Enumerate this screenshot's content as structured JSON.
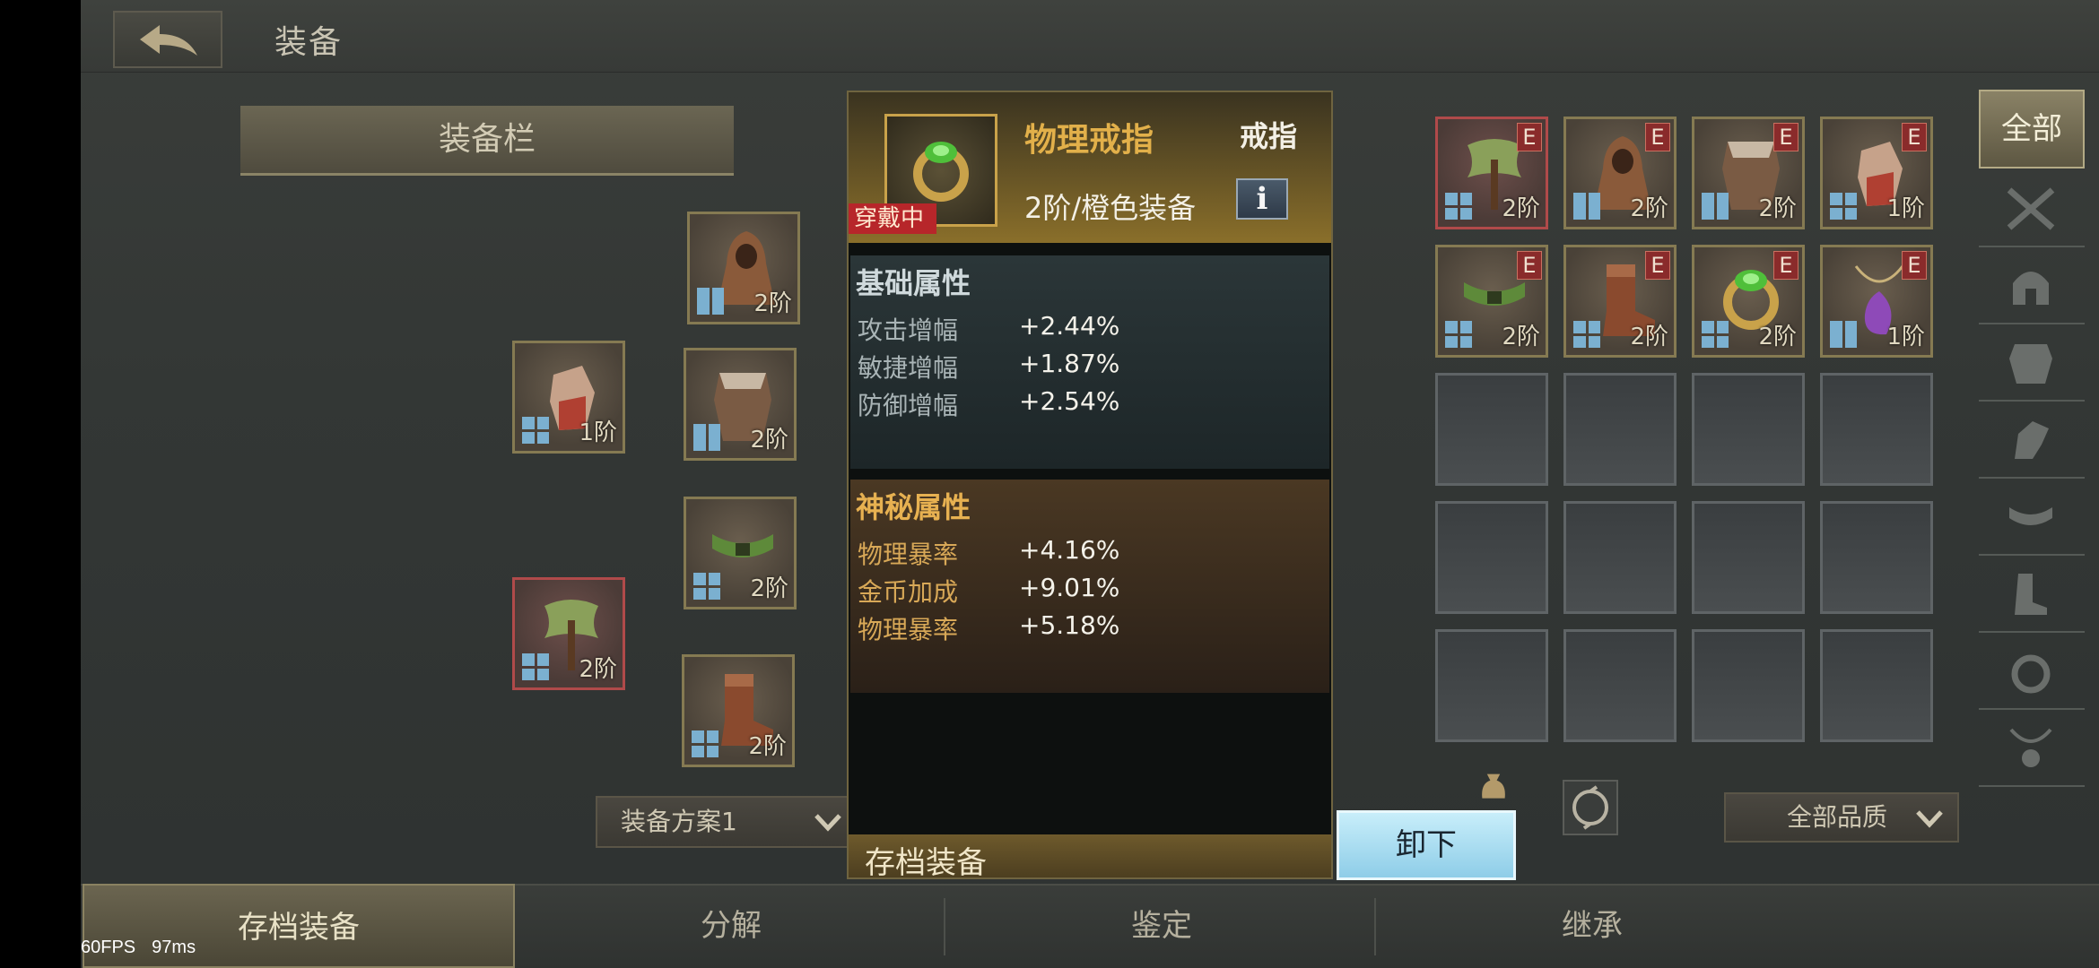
{
  "header": {
    "title": "装备"
  },
  "equipment_panel": {
    "tab_label": "装备栏",
    "preset_label": "装备方案1",
    "slots": [
      {
        "name": "cloak",
        "tier": "2阶"
      },
      {
        "name": "gauntlet",
        "tier": "1阶"
      },
      {
        "name": "armor",
        "tier": "2阶"
      },
      {
        "name": "belt",
        "tier": "2阶"
      },
      {
        "name": "axe",
        "tier": "2阶"
      },
      {
        "name": "boots",
        "tier": "2阶"
      }
    ]
  },
  "tooltip": {
    "item_name": "物理戒指",
    "item_type": "戒指",
    "grade": "2阶/橙色装备",
    "status_badge": "穿戴中",
    "info_glyph": "i",
    "base_title": "基础属性",
    "base_stats": [
      {
        "name": "攻击增幅",
        "value": "+2.44%"
      },
      {
        "name": "敏捷增幅",
        "value": "+1.87%"
      },
      {
        "name": "防御增幅",
        "value": "+2.54%"
      }
    ],
    "mystic_title": "神秘属性",
    "mystic_stats": [
      {
        "name": "物理暴率",
        "value": "+4.16%"
      },
      {
        "name": "金币加成",
        "value": "+9.01%"
      },
      {
        "name": "物理暴率",
        "value": "+5.18%"
      }
    ],
    "footer_label": "存档装备"
  },
  "unequip_button": "卸下",
  "inventory": {
    "badge_letter": "E",
    "items": [
      {
        "name": "axe",
        "tier": "2阶",
        "selected": true
      },
      {
        "name": "cloak",
        "tier": "2阶"
      },
      {
        "name": "armor",
        "tier": "2阶"
      },
      {
        "name": "gauntlet",
        "tier": "1阶"
      },
      {
        "name": "belt",
        "tier": "2阶"
      },
      {
        "name": "boots",
        "tier": "2阶"
      },
      {
        "name": "ring",
        "tier": "2阶"
      },
      {
        "name": "amulet",
        "tier": "1阶"
      }
    ],
    "quality_filter": "全部品质"
  },
  "category_filters": {
    "all_label": "全部",
    "icons": [
      "crossed-swords-icon",
      "helmet-icon",
      "chest-armor-icon",
      "glove-icon",
      "belt-icon",
      "boots-icon",
      "ring-icon",
      "necklace-icon"
    ]
  },
  "bottom_tabs": [
    "存档装备",
    "分解",
    "鉴定",
    "继承"
  ],
  "perf": {
    "fps": "60FPS",
    "latency": "97ms"
  },
  "colors": {
    "accent_gold": "#e2b04a",
    "unequip_blue": "#aee0f3",
    "wearing_red": "#b7262a"
  }
}
